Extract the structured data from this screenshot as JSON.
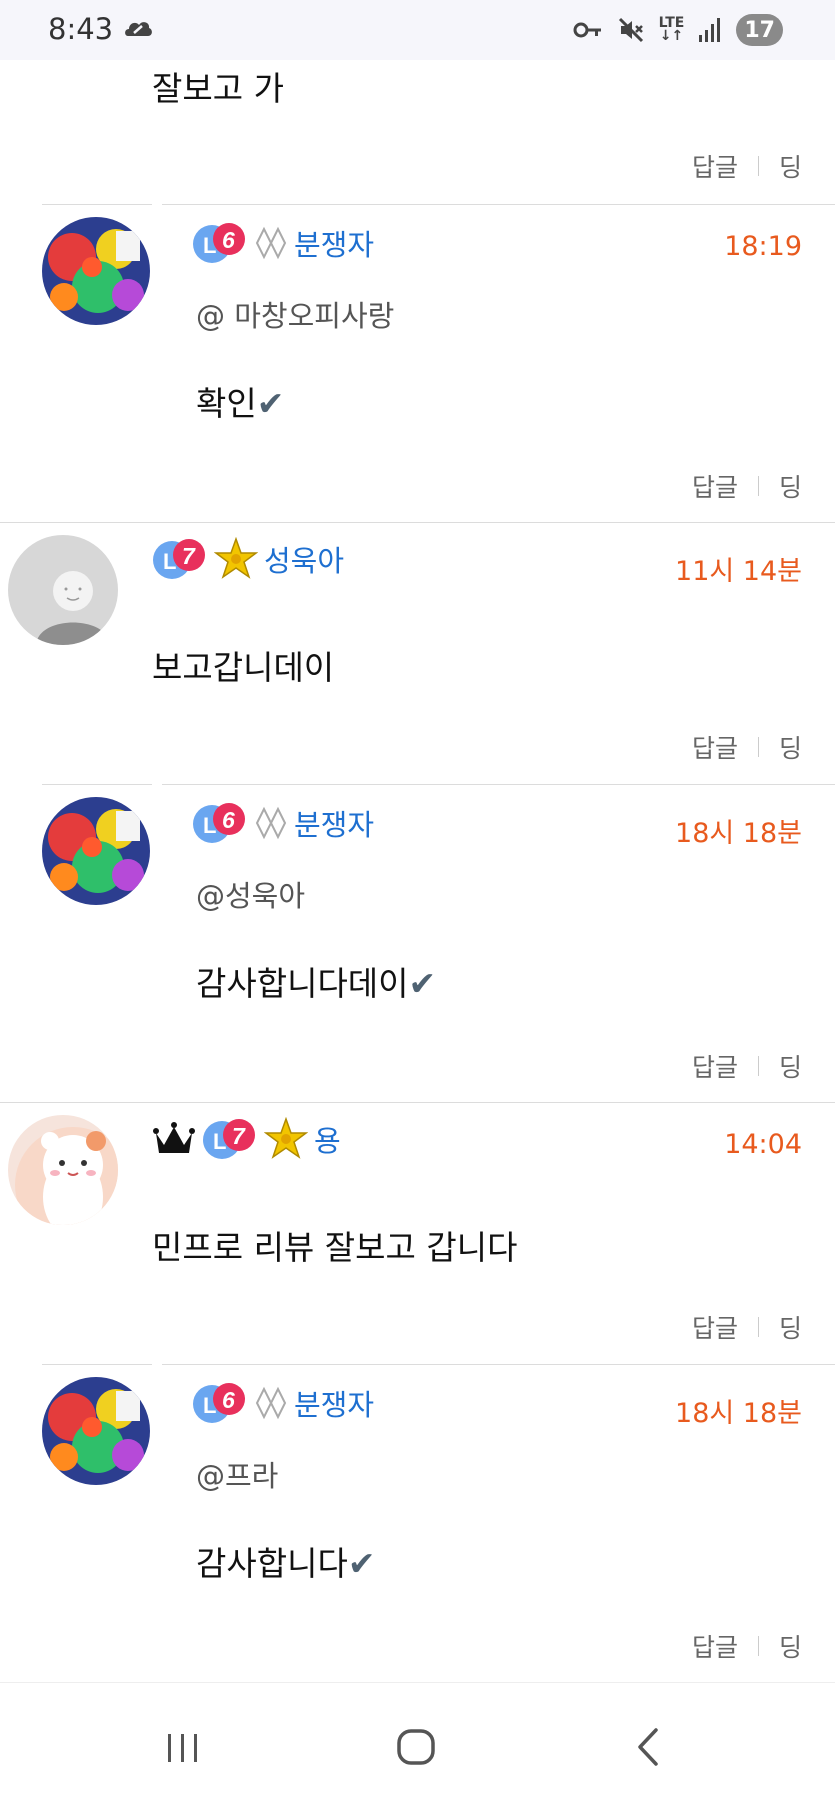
{
  "status_bar": {
    "time": "8:43",
    "battery": "17",
    "network": "LTE"
  },
  "colors": {
    "nickname": "#1e6fd0",
    "timestamp": "#e85a1e",
    "check": "#4f6272"
  },
  "comments": [
    {
      "body": "잘보고 가",
      "actions": {
        "reply": "답글",
        "ding": "딩"
      }
    },
    {
      "level": "6",
      "nickname": "분쟁자",
      "time": "18:19",
      "mention": "@ 마창오피사랑",
      "body": "확인",
      "actions": {
        "reply": "답글",
        "ding": "딩"
      }
    },
    {
      "level": "7",
      "nickname": "성욱아",
      "time": "11시 14분",
      "body": "보고갑니데이",
      "actions": {
        "reply": "답글",
        "ding": "딩"
      }
    },
    {
      "level": "6",
      "nickname": "분쟁자",
      "time": "18시 18분",
      "mention": "@성욱아",
      "body": "감사합니다데이",
      "actions": {
        "reply": "답글",
        "ding": "딩"
      }
    },
    {
      "level": "7",
      "nickname": "용",
      "time": "14:04",
      "body": "민프로 리뷰 잘보고 갑니다",
      "actions": {
        "reply": "답글",
        "ding": "딩"
      }
    },
    {
      "level": "6",
      "nickname": "분쟁자",
      "time": "18시 18분",
      "mention": "@프라",
      "body": "감사합니다",
      "actions": {
        "reply": "답글",
        "ding": "딩"
      }
    }
  ],
  "check_glyph": "✔"
}
